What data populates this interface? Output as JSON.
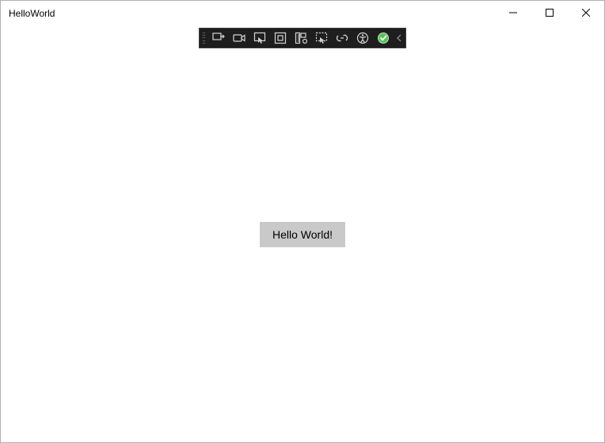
{
  "window": {
    "title": "HelloWorld"
  },
  "main": {
    "button_label": "Hello World!"
  },
  "toolbar": {
    "icons": [
      "live-visual-tree",
      "camera",
      "select-element",
      "layout-adorners",
      "hot-reload-ruler",
      "track-focus",
      "binding-diagnostics",
      "accessibility",
      "hot-reload-status"
    ]
  }
}
